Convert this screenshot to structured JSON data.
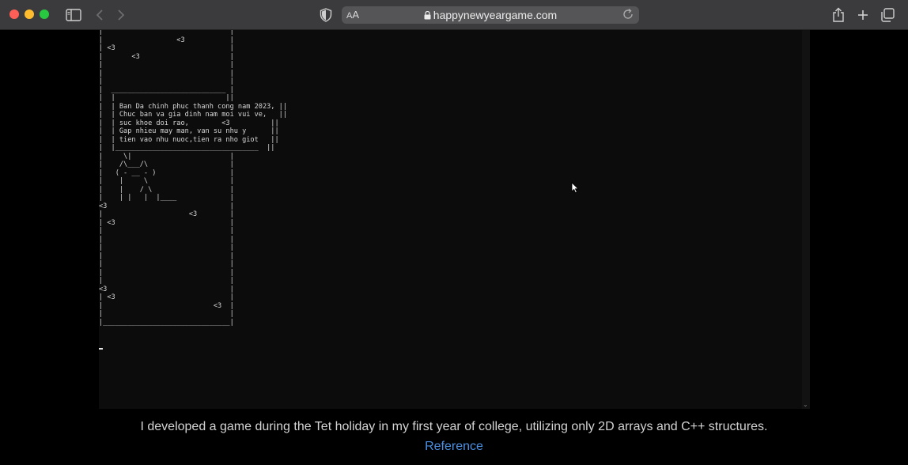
{
  "browser": {
    "url": "happynewyeargame.com",
    "text_size_label_small": "A",
    "text_size_label_large": "A"
  },
  "terminal": {
    "lines": [
      "|                               |",
      "|                  <3           |",
      "| <3                            |",
      "|       <3                      |",
      "|                               |",
      "|                               |",
      "|                               |",
      "|  ____________________________ |",
      "|  |                           ||",
      "|  | Ban Da chinh phuc thanh cong nam 2023, ||",
      "|  | Chuc ban va gia dinh nam moi vui ve,   ||",
      "|  | suc khoe doi rao,        <3          ||",
      "|  | Gap nhieu may man, van su nhu y      ||",
      "|  | tien vao nhu nuoc,tien ra nho giot   ||",
      "|  |___________________________________  ||",
      "|     \\|                        |",
      "|    /\\___/\\                    |",
      "|   ( - __ - )                  |",
      "|    |     \\                    |",
      "|    |    / \\                   |",
      "|    | |   |  |____             |",
      "<3                              |",
      "|                     <3        |",
      "| <3                            |",
      "|                               |",
      "|                               |",
      "|                               |",
      "|                               |",
      "|                               |",
      "|                               |",
      "|                               |",
      "<3                              |",
      "| <3                            |",
      "|                           <3  |",
      "|                               |",
      "|_______________________________|"
    ]
  },
  "caption": "I developed a game during the Tet holiday in my first year of college, utilizing only 2D arrays and C++ structures.",
  "reference_label": "Reference"
}
